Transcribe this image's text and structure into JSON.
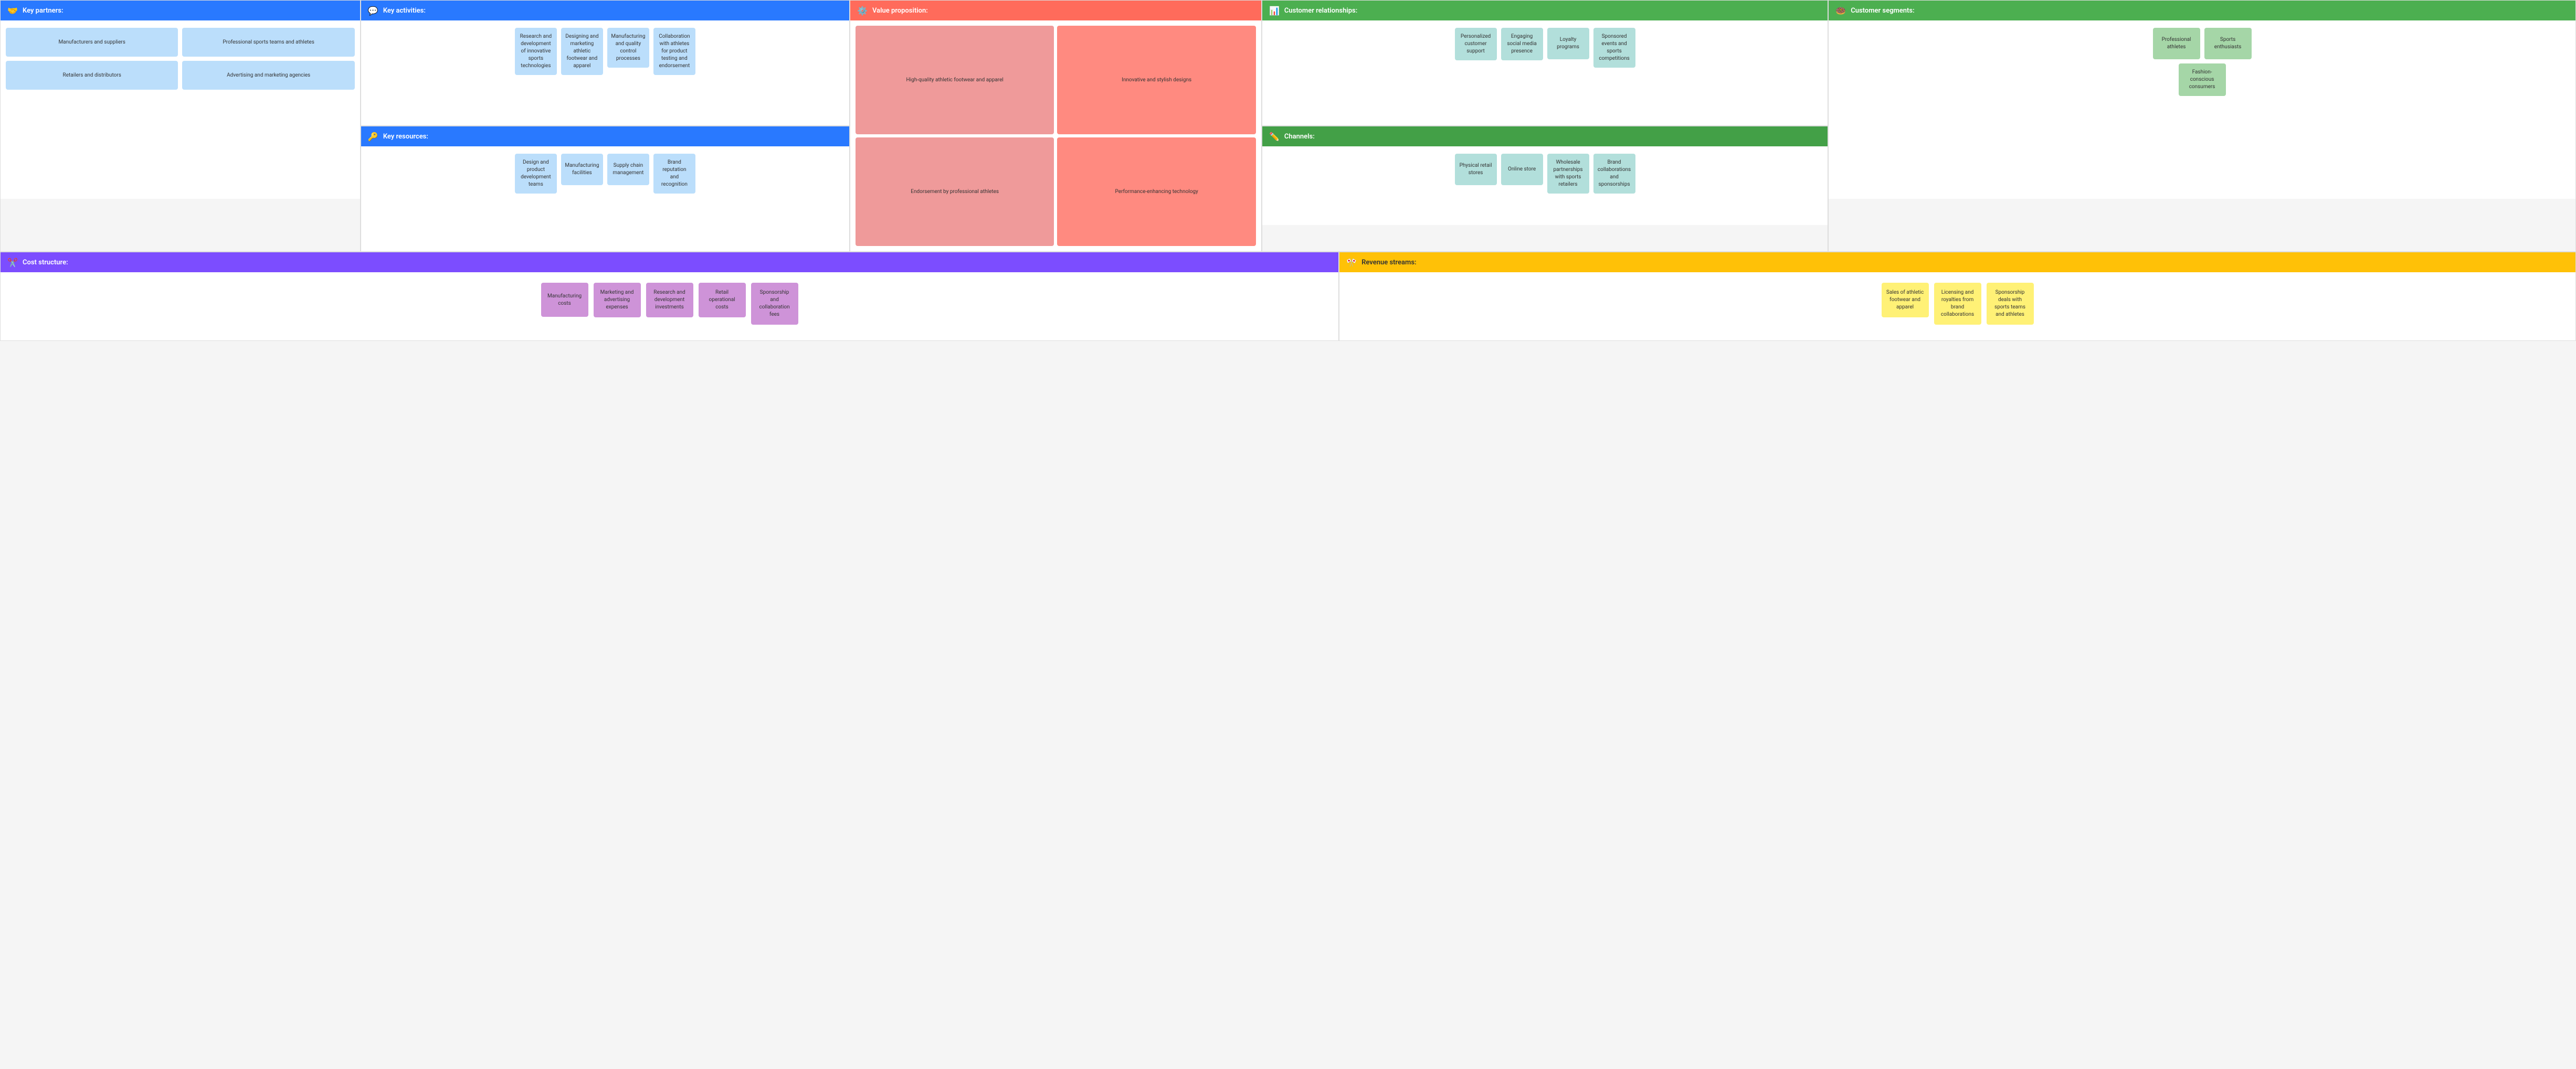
{
  "sections": {
    "key_partners": {
      "title": "Key partners:",
      "icon": "🤝",
      "cards": [
        "Manufacturers and suppliers",
        "Professional sports teams and athletes",
        "Retailers and distributors",
        "Advertising and marketing agencies"
      ]
    },
    "key_activities": {
      "title": "Key activities:",
      "icon": "💬",
      "cards": [
        "Research and development of innovative sports technologies",
        "Designing and marketing athletic footwear and apparel",
        "Manufacturing and quality control processes",
        "Collaboration with athletes for product testing and endorsement"
      ]
    },
    "key_resources": {
      "title": "Key resources:",
      "icon": "🔑",
      "cards": [
        "Design and product development teams",
        "Manufacturing facilities",
        "Supply chain management",
        "Brand reputation and recognition"
      ]
    },
    "value_proposition": {
      "title": "Value proposition:",
      "icon": "⚙️",
      "cards": [
        "High-quality athletic footwear and apparel",
        "Innovative and stylish designs",
        "Endorsement by professional athletes",
        "Performance-enhancing technology"
      ]
    },
    "customer_relationships": {
      "title": "Customer relationships:",
      "icon": "📊",
      "cards": [
        "Personalized customer support",
        "Engaging social media presence",
        "Loyalty programs",
        "Sponsored events and sports competitions"
      ]
    },
    "channels": {
      "title": "Channels:",
      "icon": "✏️",
      "cards": [
        "Physical retail stores",
        "Online store",
        "Wholesale partnerships with sports retailers",
        "Brand collaborations and sponsorships"
      ]
    },
    "customer_segments": {
      "title": "Customer segments:",
      "icon": "🍩",
      "cards": [
        "Professional athletes",
        "Sports enthusiasts",
        "Fashion-conscious consumers"
      ]
    },
    "cost_structure": {
      "title": "Cost structure:",
      "icon": "✂️",
      "cards": [
        "Manufacturing costs",
        "Marketing and advertising expenses",
        "Research and development investments",
        "Retail operational costs",
        "Sponsorship and collaboration fees"
      ]
    },
    "revenue_streams": {
      "title": "Revenue streams:",
      "icon": "🎌",
      "cards": [
        "Sales of athletic footwear and apparel",
        "Licensing and royalties from brand collaborations",
        "Sponsorship deals with sports teams and athletes"
      ]
    }
  }
}
